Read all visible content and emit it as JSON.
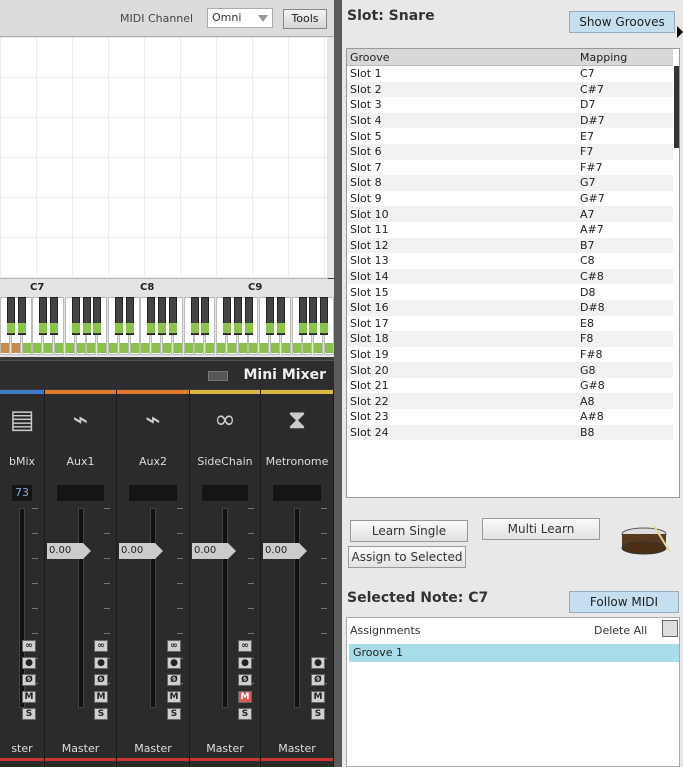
{
  "toolbar": {
    "midi_channel_label": "MIDI Channel",
    "midi_channel_value": "Omni",
    "tools_label": "Tools"
  },
  "keyboard": {
    "octave_labels": [
      "C7",
      "C8",
      "C9"
    ]
  },
  "mixer": {
    "title": "Mini Mixer",
    "strips": [
      {
        "name": "bMix",
        "value": "73",
        "fader": "",
        "output": "ster",
        "accent": "#3b7bbf",
        "icon": "mixer-icon"
      },
      {
        "name": "Aux1",
        "value": "",
        "fader": "0.00",
        "output": "Master",
        "accent": "#e07b2e",
        "icon": "cable-icon"
      },
      {
        "name": "Aux2",
        "value": "",
        "fader": "0.00",
        "output": "Master",
        "accent": "#e07b2e",
        "icon": "cable-icon"
      },
      {
        "name": "SideChain",
        "value": "",
        "fader": "0.00",
        "output": "Master",
        "accent": "#d8b840",
        "icon": "link-icon"
      },
      {
        "name": "Metronome",
        "value": "",
        "fader": "0.00",
        "output": "Master",
        "accent": "#d8b840",
        "icon": "metronome-icon"
      }
    ],
    "button_labels": {
      "link": "∞",
      "record": "●",
      "phase": "Ø",
      "mute": "M",
      "solo": "S"
    }
  },
  "slot": {
    "title": "Slot:  Snare",
    "show_grooves_label": "Show Grooves"
  },
  "groove_table": {
    "headers": [
      "Groove",
      "Mapping"
    ],
    "rows": [
      [
        "Slot 1",
        "C7"
      ],
      [
        "Slot 2",
        "C#7"
      ],
      [
        "Slot 3",
        "D7"
      ],
      [
        "Slot 4",
        "D#7"
      ],
      [
        "Slot 5",
        "E7"
      ],
      [
        "Slot 6",
        "F7"
      ],
      [
        "Slot 7",
        "F#7"
      ],
      [
        "Slot 8",
        "G7"
      ],
      [
        "Slot 9",
        "G#7"
      ],
      [
        "Slot 10",
        "A7"
      ],
      [
        "Slot 11",
        "A#7"
      ],
      [
        "Slot 12",
        "B7"
      ],
      [
        "Slot 13",
        "C8"
      ],
      [
        "Slot 14",
        "C#8"
      ],
      [
        "Slot 15",
        "D8"
      ],
      [
        "Slot 16",
        "D#8"
      ],
      [
        "Slot 17",
        "E8"
      ],
      [
        "Slot 18",
        "F8"
      ],
      [
        "Slot 19",
        "F#8"
      ],
      [
        "Slot 20",
        "G8"
      ],
      [
        "Slot 21",
        "G#8"
      ],
      [
        "Slot 22",
        "A8"
      ],
      [
        "Slot 23",
        "A#8"
      ],
      [
        "Slot 24",
        "B8"
      ]
    ]
  },
  "learn": {
    "learn_single": "Learn Single",
    "multi_learn": "Multi Learn",
    "assign_to_selected": "Assign to Selected"
  },
  "selected_note": {
    "title": "Selected Note:  C7",
    "follow_midi_label": "Follow MIDI"
  },
  "assignments": {
    "label": "Assignments",
    "delete_all": "Delete All",
    "items": [
      "Groove 1"
    ]
  }
}
